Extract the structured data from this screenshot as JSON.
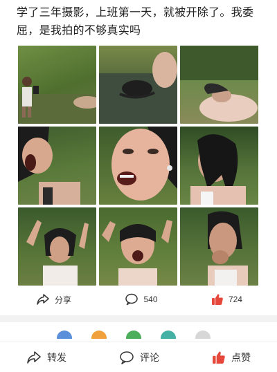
{
  "post": {
    "text": "学了三年摄影，上班第一天，就被开除了。我委屈，是我拍的不够真实吗"
  },
  "photos": [
    {
      "icon": "photo-person-by-pond"
    },
    {
      "icon": "photo-person-in-water"
    },
    {
      "icon": "photo-person-lying-back"
    },
    {
      "icon": "photo-face-screaming"
    },
    {
      "icon": "photo-face-closeup"
    },
    {
      "icon": "photo-hair-over-face"
    },
    {
      "icon": "photo-hands-raised"
    },
    {
      "icon": "photo-arms-up-shouting"
    },
    {
      "icon": "photo-hand-to-mouth"
    }
  ],
  "actions": {
    "share_label": "分享",
    "comment_count": "540",
    "like_count": "724"
  },
  "bottom_bar": {
    "forward_label": "转发",
    "comment_label": "评论",
    "like_label": "点赞"
  },
  "colors": {
    "like_accent": "#e5473b",
    "text": "#1f1f1f",
    "icon": "#333333"
  }
}
